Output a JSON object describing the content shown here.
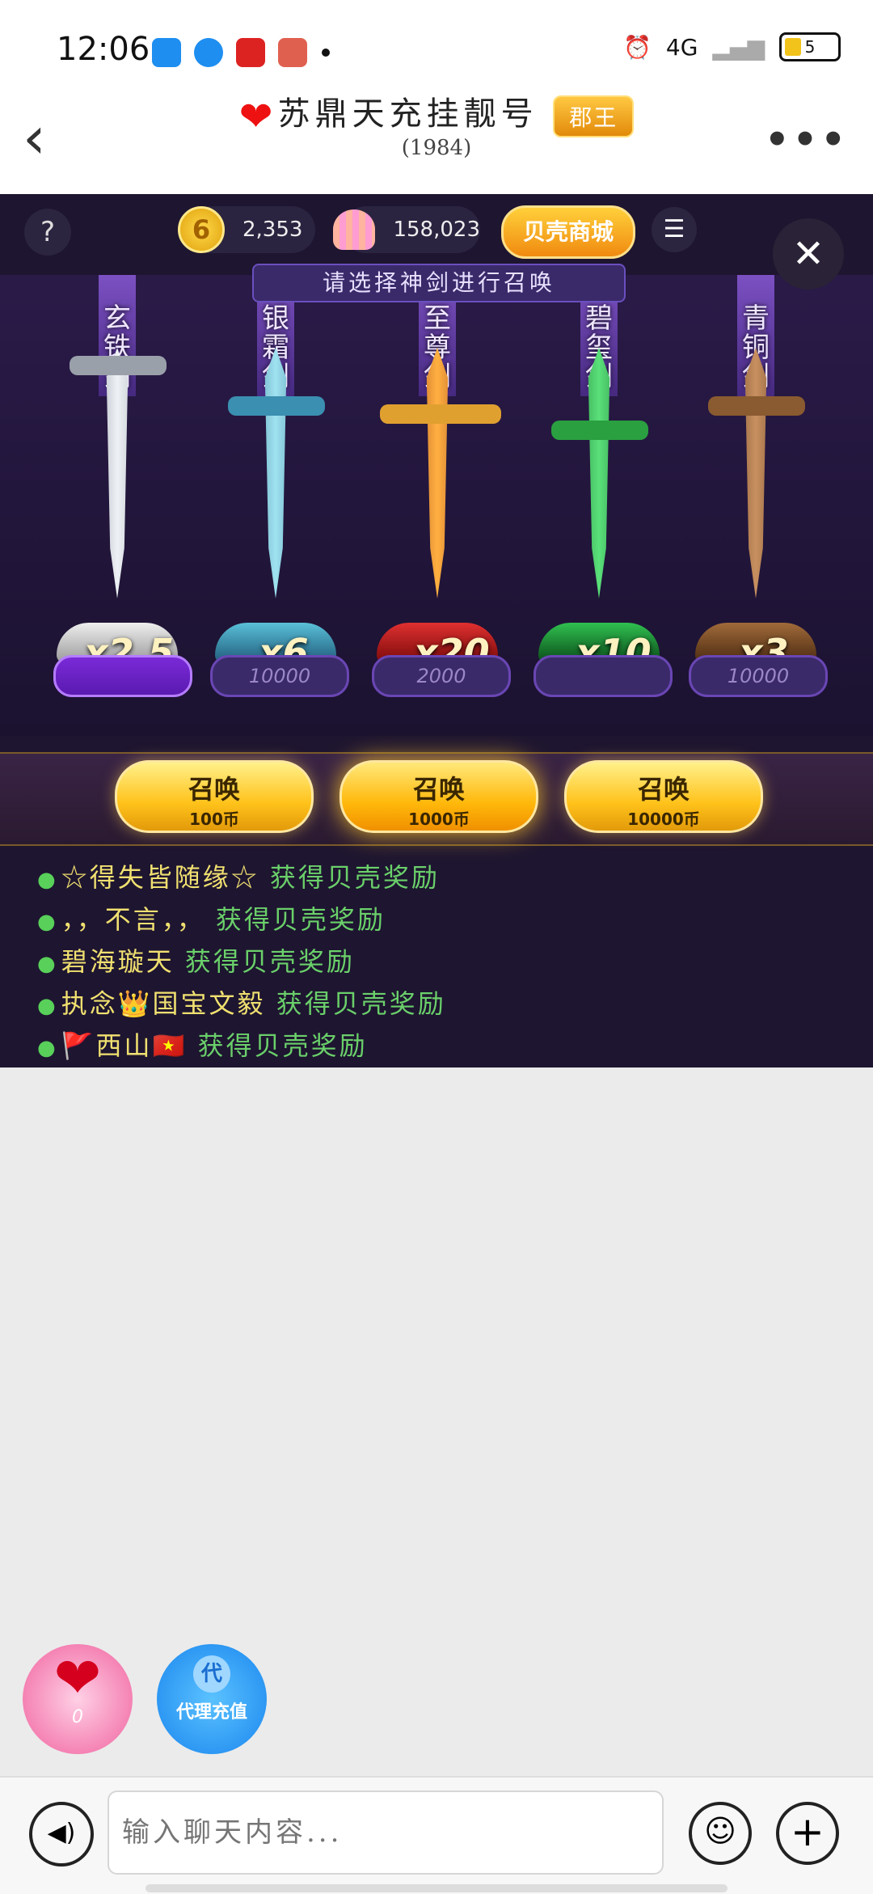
{
  "status": {
    "time": "12:06",
    "battery": "5",
    "network": "4G"
  },
  "header": {
    "back": "‹",
    "title": "苏鼎天充挂靓号",
    "rank": "郡王",
    "subtitle": "(1984)",
    "more": "•••"
  },
  "game": {
    "help": "?",
    "coins": "2,353",
    "coin_symbol": "6",
    "shells": "158,023",
    "shop": "贝壳商城",
    "menu": "☰",
    "close": "✕",
    "prompt": "请选择神剑进行召唤",
    "swords": [
      {
        "name": "玄铁剑",
        "multiplier": "x2.5",
        "price": "",
        "color": "#c8d0d8"
      },
      {
        "name": "银霜剑",
        "multiplier": "x6",
        "price": "10000",
        "color": "#4fa8c8"
      },
      {
        "name": "至尊剑",
        "multiplier": "x20",
        "price": "2000",
        "color": "#e0602a"
      },
      {
        "name": "碧玺剑",
        "multiplier": "x10",
        "price": "",
        "color": "#2fb04a"
      },
      {
        "name": "青铜剑",
        "multiplier": "x3",
        "price": "10000",
        "color": "#9a6a3a"
      }
    ],
    "summon_buttons": [
      {
        "label": "召唤",
        "cost": "100币"
      },
      {
        "label": "召唤",
        "cost": "1000币"
      },
      {
        "label": "召唤",
        "cost": "10000币"
      }
    ],
    "rewards": [
      {
        "user": "☆得失皆随缘☆",
        "text": "获得贝壳奖励"
      },
      {
        "user": "，，不言，，",
        "text": "获得贝壳奖励"
      },
      {
        "user": "碧海璇天",
        "text": "获得贝壳奖励"
      },
      {
        "user": "执念👑国宝文毅",
        "text": "获得贝壳奖励"
      },
      {
        "user": "🚩西山🇻🇳",
        "text": "获得贝壳奖励"
      }
    ]
  },
  "floating": {
    "love_label": "Love",
    "love_count": "0",
    "agent_icon": "代",
    "agent_label": "代理充值"
  },
  "input": {
    "placeholder": "输入聊天内容..."
  }
}
